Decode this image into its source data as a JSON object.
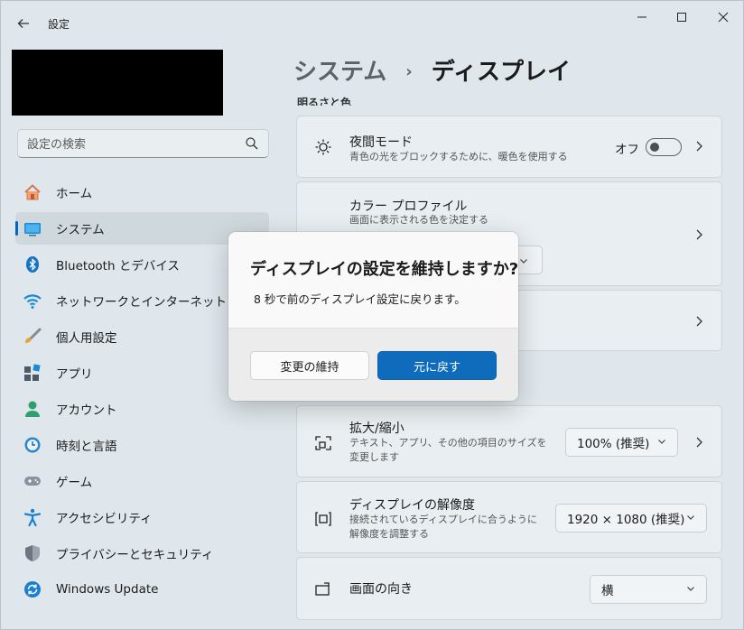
{
  "window": {
    "app_title": "設定",
    "back_icon": "arrow-left-icon",
    "controls": {
      "minimize": "─",
      "maximize": "☐",
      "close": "✕"
    }
  },
  "sidebar": {
    "search_placeholder": "設定の検索",
    "items": [
      {
        "label": "ホーム",
        "icon": "home-icon",
        "selected": false
      },
      {
        "label": "システム",
        "icon": "system-icon",
        "selected": true
      },
      {
        "label": "Bluetooth とデバイス",
        "icon": "bluetooth-icon",
        "selected": false
      },
      {
        "label": "ネットワークとインターネット",
        "icon": "wifi-icon",
        "selected": false
      },
      {
        "label": "個人用設定",
        "icon": "brush-icon",
        "selected": false
      },
      {
        "label": "アプリ",
        "icon": "apps-icon",
        "selected": false
      },
      {
        "label": "アカウント",
        "icon": "account-icon",
        "selected": false
      },
      {
        "label": "時刻と言語",
        "icon": "clock-globe-icon",
        "selected": false
      },
      {
        "label": "ゲーム",
        "icon": "gamepad-icon",
        "selected": false
      },
      {
        "label": "アクセシビリティ",
        "icon": "accessibility-icon",
        "selected": false
      },
      {
        "label": "プライバシーとセキュリティ",
        "icon": "shield-icon",
        "selected": false
      },
      {
        "label": "Windows Update",
        "icon": "update-icon",
        "selected": false
      }
    ]
  },
  "main": {
    "breadcrumb": {
      "parent": "システム",
      "separator": "›",
      "current": "ディスプレイ"
    },
    "section_brightness": "明るさと色",
    "night_light": {
      "title": "夜間モード",
      "desc": "青色の光をブロックするために、暖色を使用する",
      "toggle_label": "オフ",
      "toggle_on": false
    },
    "color_profile": {
      "title": "カラー プロファイル",
      "desc": "画面に表示される色を決定する"
    },
    "scale": {
      "title": "拡大/縮小",
      "desc": "テキスト、アプリ、その他の項目のサイズを変更します",
      "value": "100% (推奨)"
    },
    "resolution": {
      "title": "ディスプレイの解像度",
      "desc": "接続されているディスプレイに合うように解像度を調整する",
      "value": "1920 × 1080 (推奨)"
    },
    "orientation": {
      "title": "画面の向き",
      "value": "横"
    }
  },
  "dialog": {
    "title": "ディスプレイの設定を維持しますか?",
    "message": "8 秒で前のディスプレイ設定に戻ります。",
    "keep_label": "変更の維持",
    "revert_label": "元に戻す"
  },
  "colors": {
    "accent": "#0f6cbd",
    "window_bg": "#dfe7ec"
  }
}
